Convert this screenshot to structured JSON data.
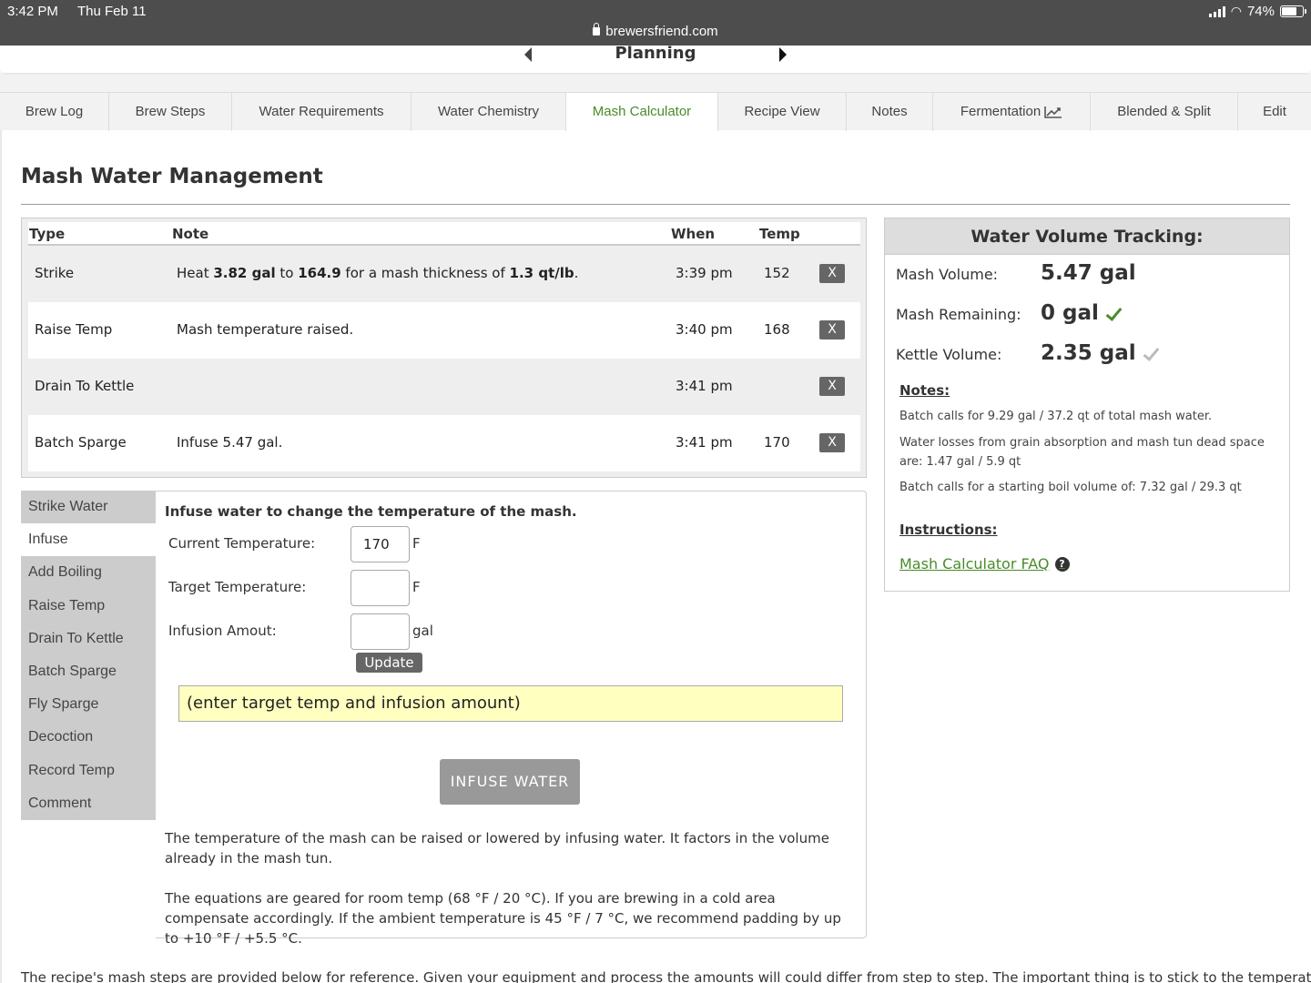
{
  "status": {
    "time": "3:42 PM",
    "date": "Thu Feb 11",
    "url": "brewersfriend.com",
    "battery": "74%",
    "battery_level": 0.74
  },
  "plan": {
    "title": "Planning"
  },
  "tabs": [
    {
      "label": "Brew Log",
      "active": false
    },
    {
      "label": "Brew Steps",
      "active": false
    },
    {
      "label": "Water Requirements",
      "active": false
    },
    {
      "label": "Water Chemistry",
      "active": false
    },
    {
      "label": "Mash Calculator",
      "active": true
    },
    {
      "label": "Recipe View",
      "active": false
    },
    {
      "label": "Notes",
      "active": false
    },
    {
      "label": "Fermentation",
      "active": false,
      "icon": "chart-icon"
    },
    {
      "label": "Blended & Split",
      "active": false
    },
    {
      "label": "Edit",
      "active": false
    }
  ],
  "page": {
    "title": "Mash Water Management"
  },
  "steps": {
    "headers": {
      "type": "Type",
      "note": "Note",
      "when": "When",
      "temp": "Temp"
    },
    "delete_label": "X",
    "rows": [
      {
        "type": "Strike",
        "note_prefix": "Heat ",
        "note_b1": "3.82 gal",
        "note_mid1": " to ",
        "note_b2": "164.9",
        "note_mid2": " for a mash thickness of ",
        "note_b3": "1.3 qt/lb",
        "note_suffix": ".",
        "when": "3:39 pm",
        "temp": "152"
      },
      {
        "type": "Raise Temp",
        "note": "Mash temperature raised.",
        "when": "3:40 pm",
        "temp": "168"
      },
      {
        "type": "Drain To Kettle",
        "note": "",
        "when": "3:41 pm",
        "temp": ""
      },
      {
        "type": "Batch Sparge",
        "note": "Infuse 5.47 gal.",
        "when": "3:41 pm",
        "temp": "170"
      }
    ]
  },
  "menu": {
    "items": [
      "Strike Water",
      "Infuse",
      "Add Boiling",
      "Raise Temp",
      "Drain To Kettle",
      "Batch Sparge",
      "Fly Sparge",
      "Decoction",
      "Record Temp",
      "Comment"
    ],
    "active": "Infuse"
  },
  "infuse": {
    "title": "Infuse water to change the temperature of the mash.",
    "current_label": "Current Temperature:",
    "current_value": "170",
    "current_unit": "F",
    "target_label": "Target Temperature:",
    "target_value": "",
    "target_unit": "F",
    "amount_label": "Infusion Amout:",
    "amount_value": "",
    "amount_unit": "gal",
    "update_label": "Update",
    "result": "(enter target temp and infusion amount)",
    "button_label": "INFUSE WATER",
    "para1": "The temperature of the mash can be raised or lowered by infusing water. It factors in the volume already in the mash tun.",
    "para2": "The equations are geared for room temp (68 °F / 20 °C). If you are brewing in a cold area compensate accordingly. If the ambient temperature is 45 °F / 7 °C, we recommend padding by up to +10 °F / +5.5 °C."
  },
  "tracking": {
    "title": "Water Volume Tracking:",
    "mash_volume_label": "Mash Volume:",
    "mash_volume_value": "5.47 gal",
    "mash_remaining_label": "Mash Remaining:",
    "mash_remaining_value": "0 gal",
    "kettle_volume_label": "Kettle Volume:",
    "kettle_volume_value": "2.35 gal",
    "notes_heading": "Notes:",
    "notes": [
      "Batch calls for 9.29 gal / 37.2 qt of total mash water.",
      "Water losses from grain absorption and mash tun dead space are: 1.47 gal / 5.9 qt",
      "Batch calls for a starting boil volume of: 7.32 gal / 29.3 qt"
    ],
    "instructions_heading": "Instructions:",
    "faq_label": "Mash Calculator FAQ",
    "accent": "#4a8c2a"
  },
  "footer": {
    "text": "The recipe's mash steps are provided below for reference. Given your equipment and process the amounts will could differ from step to step. The important thing is to stick to the temperatures"
  }
}
